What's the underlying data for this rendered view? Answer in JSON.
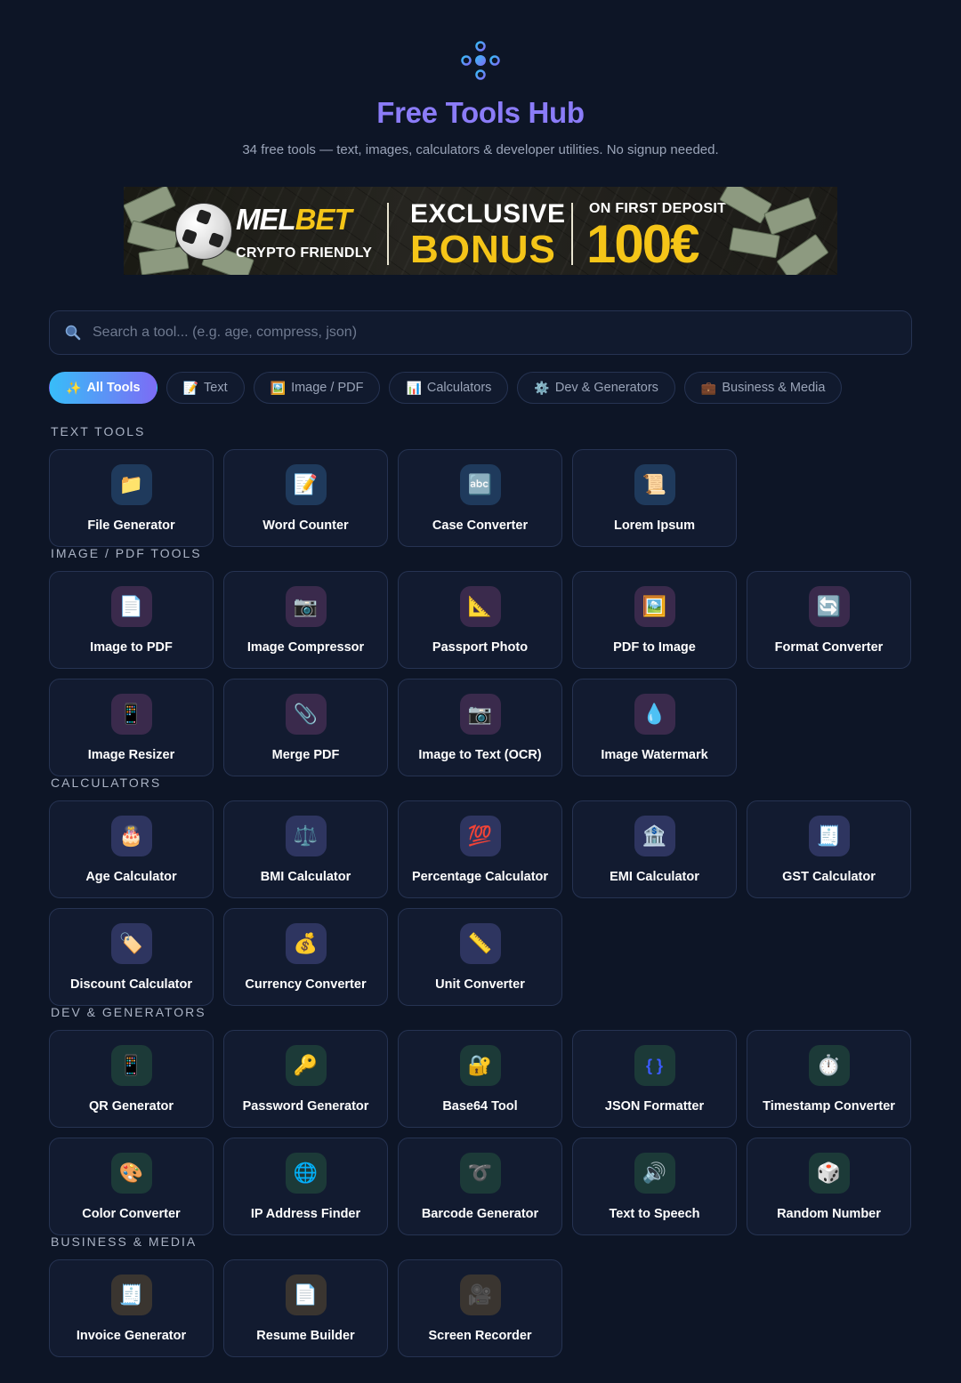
{
  "header": {
    "title": "Free Tools Hub",
    "subtitle": "34 free tools — text, images, calculators & developer utilities. No signup needed."
  },
  "banner": {
    "brand_part1": "MEL",
    "brand_part2": "BET",
    "tagline": "CRYPTO FRIENDLY",
    "headline": "EXCLUSIVE",
    "headline2": "BONUS",
    "deposit_text": "ON FIRST DEPOSIT",
    "amount": "100€"
  },
  "search": {
    "placeholder": "Search a tool... (e.g. age, compress, json)"
  },
  "filters": [
    {
      "emoji": "✨",
      "label": "All Tools",
      "active": true
    },
    {
      "emoji": "📝",
      "label": "Text"
    },
    {
      "emoji": "🖼️",
      "label": "Image / PDF"
    },
    {
      "emoji": "📊",
      "label": "Calculators"
    },
    {
      "emoji": "⚙️",
      "label": "Dev & Generators"
    },
    {
      "emoji": "💼",
      "label": "Business & Media"
    }
  ],
  "sections": [
    {
      "title": "TEXT TOOLS",
      "tools": [
        {
          "emoji": "📁",
          "label": "File Generator",
          "icon_bg": "#1f3a5c"
        },
        {
          "emoji": "📝",
          "label": "Word Counter",
          "icon_bg": "#1f3a5c"
        },
        {
          "emoji": "🔤",
          "label": "Case Converter",
          "icon_bg": "#1f3a5c"
        },
        {
          "emoji": "📜",
          "label": "Lorem Ipsum",
          "icon_bg": "#1f3a5c"
        }
      ]
    },
    {
      "title": "IMAGE / PDF TOOLS",
      "tools": [
        {
          "emoji": "📄",
          "label": "Image to PDF",
          "icon_bg": "#3a2a4c"
        },
        {
          "emoji": "📷",
          "label": "Image Compressor",
          "icon_bg": "#3a2a4c"
        },
        {
          "emoji": "📐",
          "label": "Passport Photo",
          "icon_bg": "#3a2a4c"
        },
        {
          "emoji": "🖼️",
          "label": "PDF to Image",
          "icon_bg": "#3a2a4c"
        },
        {
          "emoji": "🔄",
          "label": "Format Converter",
          "icon_bg": "#3a2a4c"
        },
        {
          "emoji": "📱",
          "label": "Image Resizer",
          "icon_bg": "#3a2a4c"
        },
        {
          "emoji": "📎",
          "label": "Merge PDF",
          "icon_bg": "#3a2a4c"
        },
        {
          "emoji": "📷",
          "label": "Image to Text (OCR)",
          "icon_bg": "#3a2a4c"
        },
        {
          "emoji": "💧",
          "label": "Image Watermark",
          "icon_bg": "#3a2a4c"
        }
      ]
    },
    {
      "title": "CALCULATORS",
      "tools": [
        {
          "emoji": "🎂",
          "label": "Age Calculator",
          "icon_bg": "#2e3560"
        },
        {
          "emoji": "⚖️",
          "label": "BMI Calculator",
          "icon_bg": "#2e3560"
        },
        {
          "emoji": "💯",
          "label": "Percentage Calculator",
          "icon_bg": "#2e3560"
        },
        {
          "emoji": "🏦",
          "label": "EMI Calculator",
          "icon_bg": "#2e3560"
        },
        {
          "emoji": "🧾",
          "label": "GST Calculator",
          "icon_bg": "#2e3560"
        },
        {
          "emoji": "🏷️",
          "label": "Discount Calculator",
          "icon_bg": "#2e3560"
        },
        {
          "emoji": "💰",
          "label": "Currency Converter",
          "icon_bg": "#2e3560"
        },
        {
          "emoji": "📏",
          "label": "Unit Converter",
          "icon_bg": "#2e3560"
        }
      ]
    },
    {
      "title": "DEV & GENERATORS",
      "tools": [
        {
          "emoji": "📱",
          "label": "QR Generator",
          "icon_bg": "#1c3a38"
        },
        {
          "emoji": "🔑",
          "label": "Password Generator",
          "icon_bg": "#1c3a38"
        },
        {
          "emoji": "🔐",
          "label": "Base64 Tool",
          "icon_bg": "#1c3a38"
        },
        {
          "emoji": "{ }",
          "label": "JSON Formatter",
          "icon_bg": "#1c3a38"
        },
        {
          "emoji": "⏱️",
          "label": "Timestamp Converter",
          "icon_bg": "#1c3a38"
        },
        {
          "emoji": "🎨",
          "label": "Color Converter",
          "icon_bg": "#1c3a38"
        },
        {
          "emoji": "🌐",
          "label": "IP Address Finder",
          "icon_bg": "#1c3a38"
        },
        {
          "emoji": "➰",
          "label": "Barcode Generator",
          "icon_bg": "#1c3a38"
        },
        {
          "emoji": "🔊",
          "label": "Text to Speech",
          "icon_bg": "#1c3a38"
        },
        {
          "emoji": "🎲",
          "label": "Random Number",
          "icon_bg": "#1c3a38"
        }
      ]
    },
    {
      "title": "BUSINESS & MEDIA",
      "tools": [
        {
          "emoji": "🧾",
          "label": "Invoice Generator",
          "icon_bg": "#3a3530"
        },
        {
          "emoji": "📄",
          "label": "Resume Builder",
          "icon_bg": "#3a3530"
        },
        {
          "emoji": "🎥",
          "label": "Screen Recorder",
          "icon_bg": "#3a3530"
        }
      ]
    }
  ]
}
